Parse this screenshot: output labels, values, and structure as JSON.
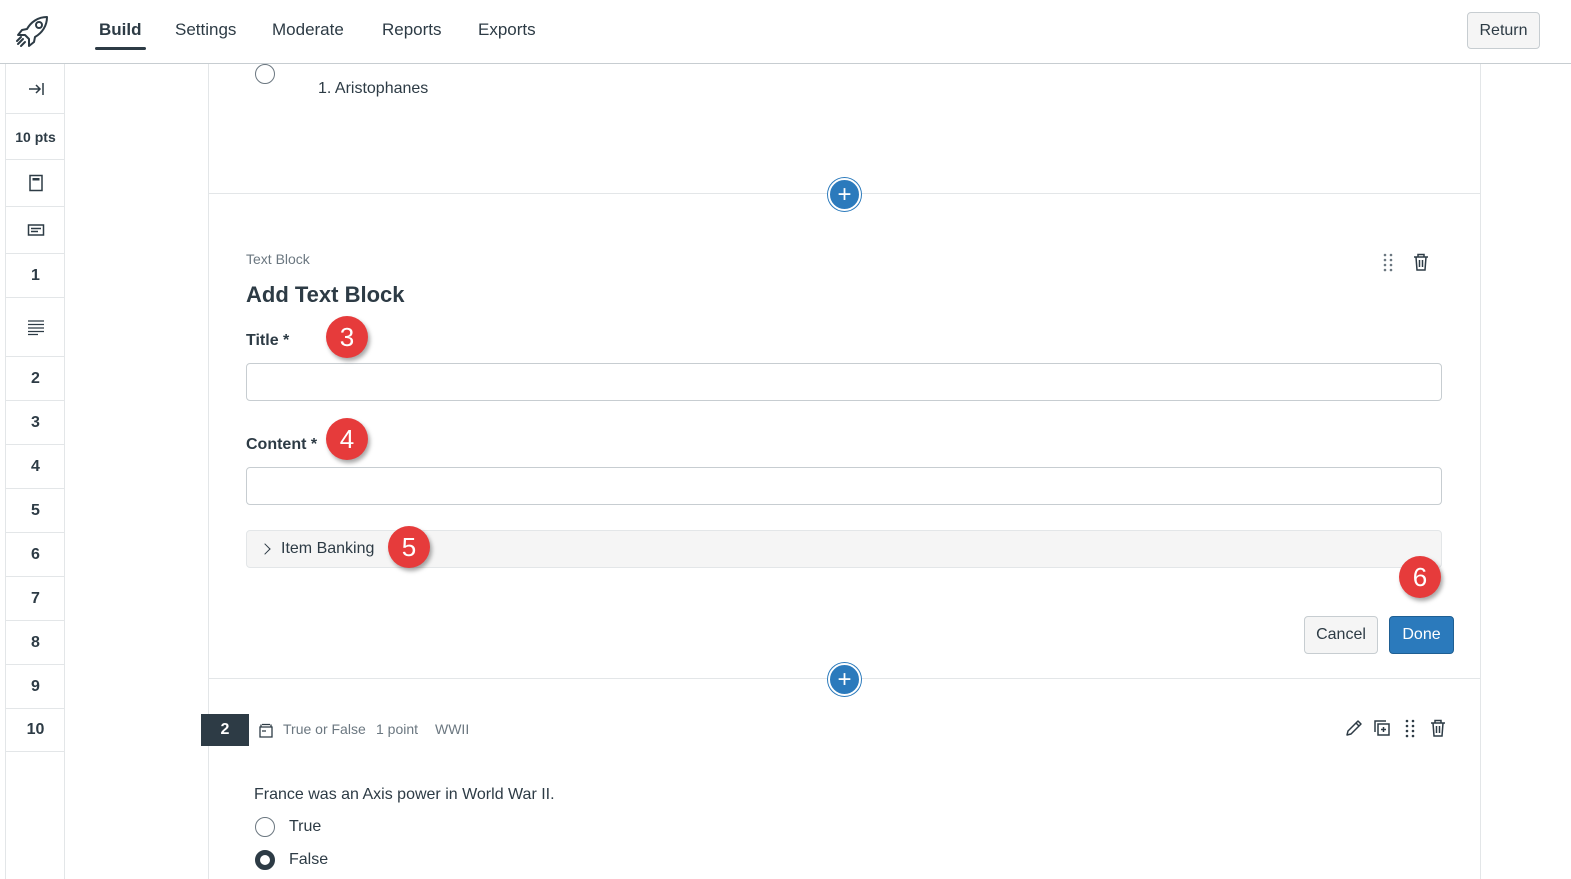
{
  "topnav": {
    "tabs": [
      {
        "label": "Build",
        "active": true
      },
      {
        "label": "Settings",
        "active": false
      },
      {
        "label": "Moderate",
        "active": false
      },
      {
        "label": "Reports",
        "active": false
      },
      {
        "label": "Exports",
        "active": false
      }
    ],
    "return_label": "Return",
    "logo_icon": "rocket-icon"
  },
  "rail": {
    "collapse_icon": "collapse-arrow-icon",
    "points": "10 pts",
    "items": [
      "1",
      "2",
      "3",
      "4",
      "5",
      "6",
      "7",
      "8",
      "9",
      "10"
    ]
  },
  "previous_question": {
    "answer_label": "1. Aristophanes"
  },
  "text_block": {
    "type_label": "Text Block",
    "heading": "Add Text Block",
    "title_label": "Title *",
    "title_value": "",
    "content_label": "Content *",
    "content_value": "",
    "item_banking_label": "Item Banking",
    "cancel_label": "Cancel",
    "done_label": "Done"
  },
  "callouts": [
    "3",
    "4",
    "5",
    "6"
  ],
  "question2": {
    "number": "2",
    "type": "True or False",
    "points": "1 point",
    "tag": "WWII",
    "prompt": "France was an Axis power in World War II.",
    "options": [
      {
        "label": "True",
        "selected": false
      },
      {
        "label": "False",
        "selected": true
      }
    ]
  },
  "colors": {
    "primary": "#2b7abc",
    "text": "#2d3b45",
    "callout": "#e63b3b",
    "border": "#c7cdd1"
  }
}
